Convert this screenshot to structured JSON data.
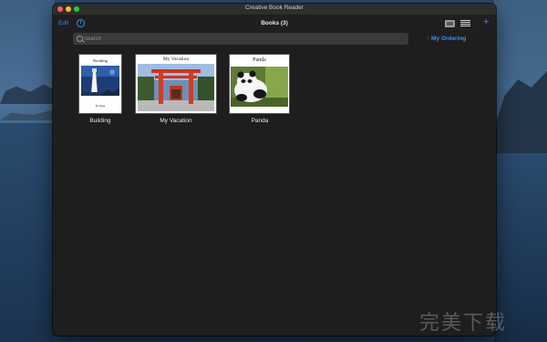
{
  "window": {
    "title": "Creative Book Reader"
  },
  "toolbar": {
    "edit_label": "Edit",
    "info_icon": "ⓘ",
    "books_title": "Books (3)",
    "add_label": "+"
  },
  "search": {
    "placeholder": "Search"
  },
  "sort": {
    "label": "↑ My Ordering"
  },
  "books": [
    {
      "label": "Building",
      "cover_title": "Building",
      "cover_author": "By Sigur"
    },
    {
      "label": "My Vacation",
      "cover_title": "My Vacation"
    },
    {
      "label": "Panda",
      "cover_title": "Panda"
    }
  ],
  "watermark": "完美下载",
  "colors": {
    "accent": "#3a8dff",
    "window_bg": "#1e1e1e",
    "title_bar": "#2e2e2e"
  }
}
